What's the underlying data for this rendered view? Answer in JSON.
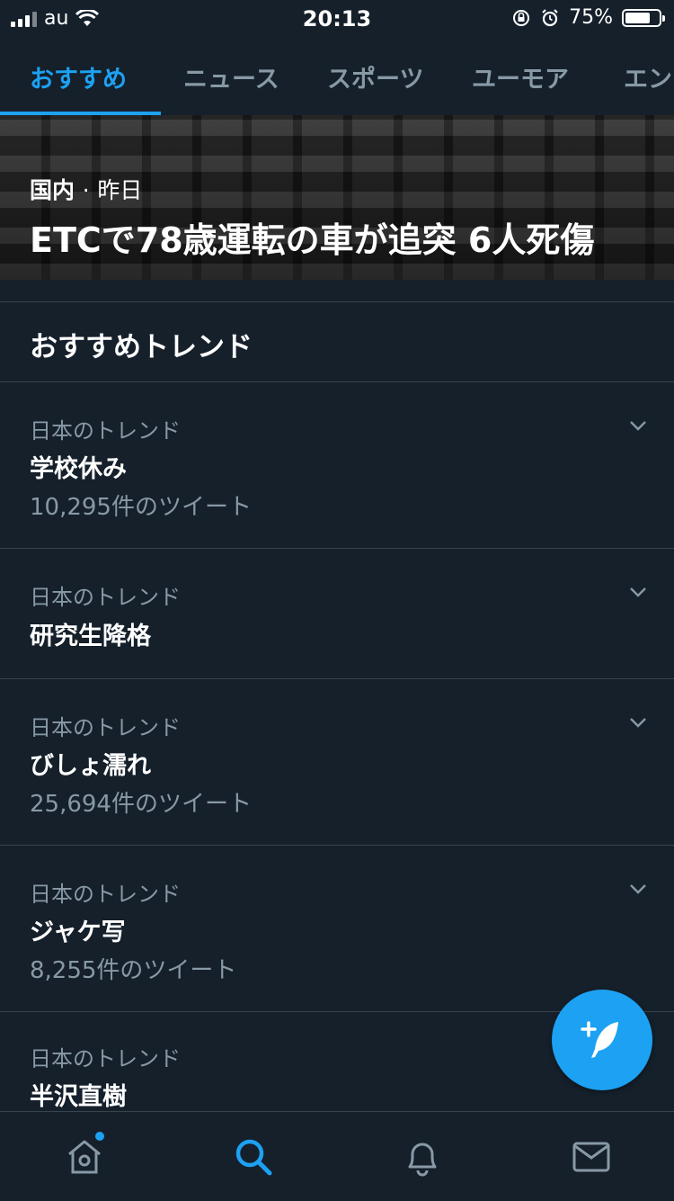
{
  "status_bar": {
    "carrier": "au",
    "time": "20:13",
    "battery_percent_text": "75%",
    "battery_level": 0.75
  },
  "tabs": [
    {
      "label": "おすすめ",
      "active": true
    },
    {
      "label": "ニュース",
      "active": false
    },
    {
      "label": "スポーツ",
      "active": false
    },
    {
      "label": "ユーモア",
      "active": false
    },
    {
      "label": "エン",
      "active": false
    }
  ],
  "hero": {
    "category": "国内",
    "separator": "·",
    "when": "昨日",
    "headline": "ETCで78歳運転の車が追突 6人死傷"
  },
  "section": {
    "title": "おすすめトレンド"
  },
  "trends": [
    {
      "category": "日本のトレンド",
      "name": "学校休み",
      "count": "10,295件のツイート"
    },
    {
      "category": "日本のトレンド",
      "name": "研究生降格",
      "count": ""
    },
    {
      "category": "日本のトレンド",
      "name": "びしょ濡れ",
      "count": "25,694件のツイート"
    },
    {
      "category": "日本のトレンド",
      "name": "ジャケ写",
      "count": "8,255件のツイート"
    },
    {
      "category": "日本のトレンド",
      "name": "半沢直樹",
      "count": ""
    }
  ],
  "colors": {
    "background": "#15202b",
    "accent": "#1da1f2",
    "secondary_text": "#8899a6",
    "divider": "#38444d"
  },
  "icons": {
    "compose": "compose-tweet-icon",
    "home": "home-icon",
    "search": "search-icon",
    "notifications": "bell-icon",
    "messages": "envelope-icon"
  }
}
